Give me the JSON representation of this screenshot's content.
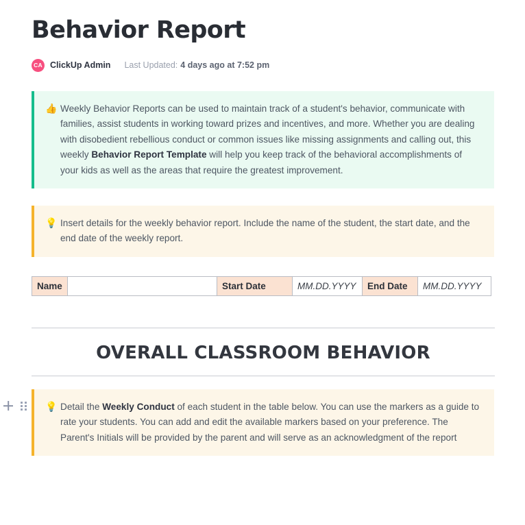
{
  "document": {
    "title": "Behavior Report",
    "byline": {
      "avatar_initials": "CA",
      "avatar_color": "#f74f7f",
      "author": "ClickUp Admin",
      "updated_label": "Last Updated:",
      "updated_value": "4 days ago at 7:52 pm"
    }
  },
  "gutter": {
    "add_icon": "plus-icon",
    "drag_icon": "drag-handle-icon"
  },
  "callouts": {
    "intro": {
      "emoji": "👍",
      "emoji_name": "thumbs-up-emoji",
      "accent_color": "#16bd8c",
      "background_color": "#eafaf2",
      "text_part_1": "Weekly Behavior Reports can be used to maintain track of a student's behavior, communicate with families, assist students in working toward prizes and incentives, and more. Whether you are dealing with disobedient rebellious conduct or common issues like missing assignments and calling out, this weekly ",
      "text_bold": "Behavior Report Template",
      "text_part_2": " will help you keep track of the behavioral accomplishments of your kids as well as the areas that require the greatest improvement."
    },
    "details": {
      "emoji": "💡",
      "emoji_name": "lightbulb-emoji",
      "accent_color": "#f5b32c",
      "background_color": "#fdf6e8",
      "text": "Insert details for the weekly behavior report. Include the name of the student, the start date, and the end date of the weekly report."
    },
    "conduct": {
      "emoji": "💡",
      "emoji_name": "lightbulb-emoji",
      "accent_color": "#f5b32c",
      "background_color": "#fdf6e8",
      "text_part_1": "Detail the ",
      "text_bold": "Weekly Conduct",
      "text_part_2": " of each student in the table below. You can use the markers as a guide to rate your students. You can add and edit the available markers based on your preference. The Parent's Initials will be provided by the parent and will serve as an acknowledgment of the report"
    }
  },
  "info_table": {
    "header_cell_color": "#fbe2d2",
    "row": [
      {
        "kind": "label",
        "value": "Name"
      },
      {
        "kind": "blank",
        "value": ""
      },
      {
        "kind": "label",
        "value": "Start Date"
      },
      {
        "kind": "placeholder",
        "value": "MM.DD.YYYY"
      },
      {
        "kind": "label",
        "value": "End Date"
      },
      {
        "kind": "placeholder",
        "value": "MM.DD.YYYY"
      }
    ]
  },
  "section": {
    "heading": "OVERALL CLASSROOM BEHAVIOR"
  }
}
